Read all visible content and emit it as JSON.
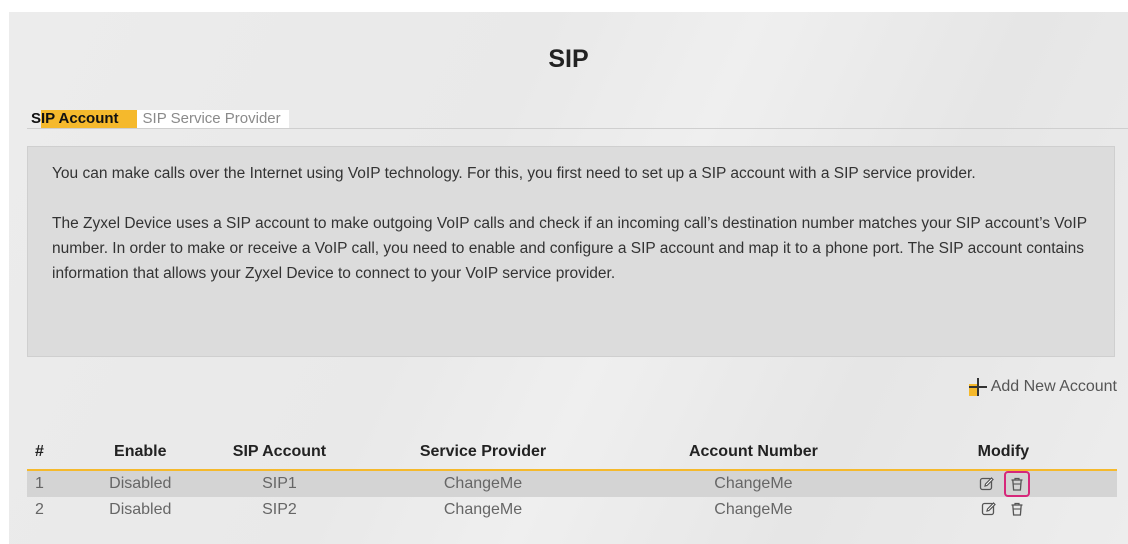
{
  "page": {
    "title": "SIP"
  },
  "tabs": [
    {
      "label": "SIP Account",
      "active": true
    },
    {
      "label": "SIP Service Provider",
      "active": false
    }
  ],
  "info": {
    "paragraph1": "You can make calls over the Internet using VoIP technology. For this, you first need to set up a SIP account with a SIP service provider.",
    "paragraph2": "The Zyxel Device uses a SIP account to make outgoing VoIP calls and check if an incoming call’s destination number matches your SIP account’s VoIP number. In order to make or receive a VoIP call, you need to enable and configure a SIP account and map it to a phone port. The SIP account contains information that allows your Zyxel Device to connect to your VoIP service provider."
  },
  "actions": {
    "add_new_account": "Add New Account"
  },
  "table": {
    "headers": [
      "#",
      "Enable",
      "SIP Account",
      "Service Provider",
      "Account Number",
      "Modify"
    ],
    "rows": [
      {
        "num": "1",
        "enable": "Disabled",
        "sip_account": "SIP1",
        "service_provider": "ChangeMe",
        "account_number": "ChangeMe"
      },
      {
        "num": "2",
        "enable": "Disabled",
        "sip_account": "SIP2",
        "service_provider": "ChangeMe",
        "account_number": "ChangeMe"
      }
    ]
  },
  "colors": {
    "accent": "#f5b92c",
    "highlight_border": "#d6277a",
    "panel_bg": "#ececec",
    "info_bg": "#dcdcdc"
  },
  "icons": {
    "add": "plus-icon",
    "edit": "edit-icon",
    "delete": "trash-icon"
  }
}
